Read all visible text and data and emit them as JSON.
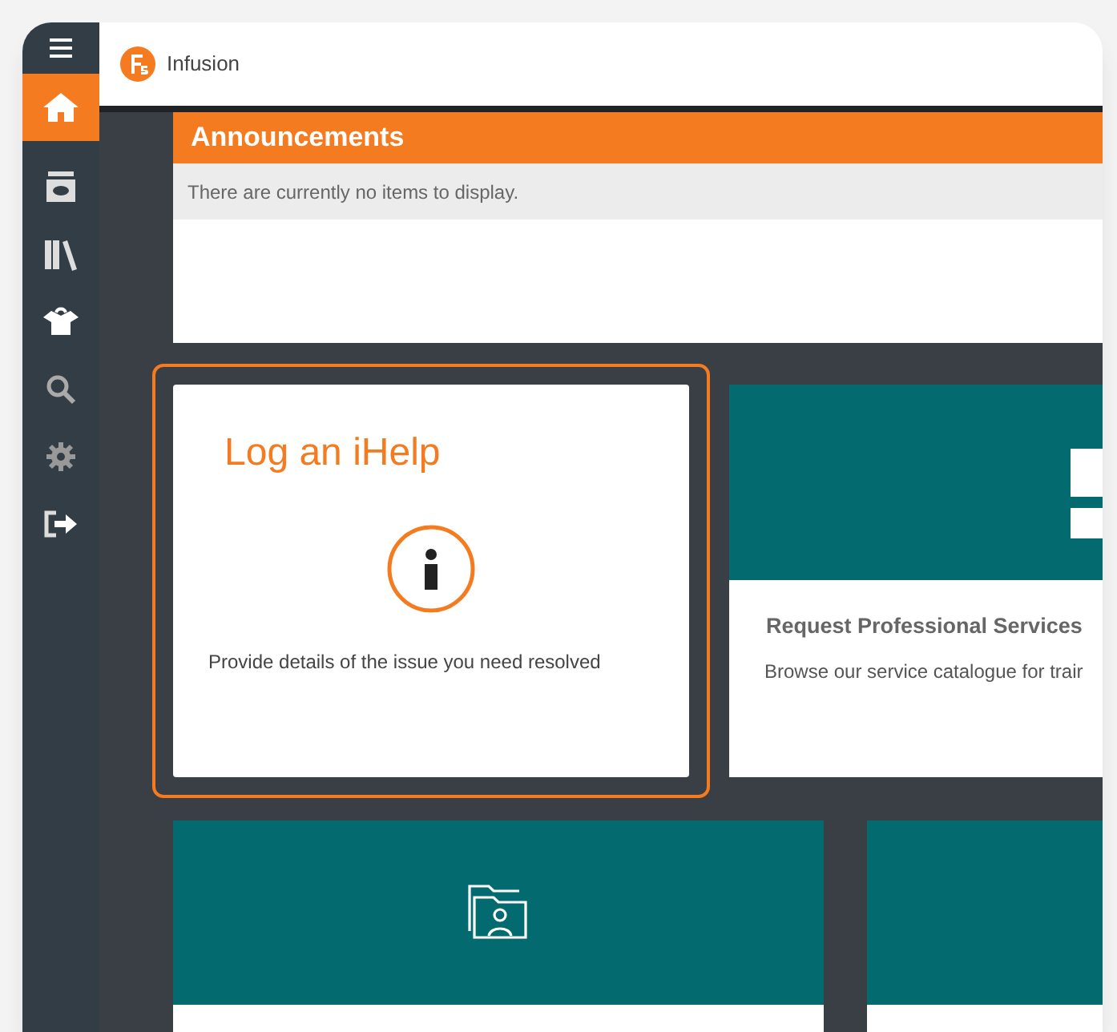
{
  "sidebar": {
    "items": [
      {
        "kind": "menu",
        "selected": false
      },
      {
        "kind": "home",
        "selected": true
      },
      {
        "kind": "inbox",
        "selected": false
      },
      {
        "kind": "books",
        "selected": false
      },
      {
        "kind": "box",
        "selected": false
      },
      {
        "kind": "search",
        "selected": false
      },
      {
        "kind": "gear",
        "selected": false
      },
      {
        "kind": "logout",
        "selected": false
      }
    ]
  },
  "header": {
    "app_name": "Infusion"
  },
  "announcements": {
    "title": "Announcements",
    "message": "There are currently no items to display."
  },
  "tiles": [
    {
      "kind": "text",
      "title": "Log an iHelp",
      "description": "Provide details of the issue you need resolved",
      "selected": true
    },
    {
      "kind": "image",
      "title": "Request Professional Services",
      "description": "Browse our service catalogue for trair",
      "selected": false
    },
    {
      "kind": "folder",
      "selected": false
    },
    {
      "kind": "plain",
      "selected": false
    }
  ]
}
